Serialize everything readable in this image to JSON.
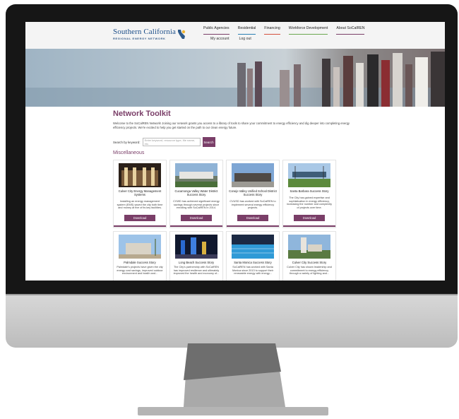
{
  "site": {
    "logo_main": "Southern California",
    "logo_sub": "REGIONAL ENERGY NETWORK"
  },
  "nav": {
    "items": [
      "Public Agencies",
      "Residential",
      "Financing",
      "Workforce Development",
      "About SoCalREN"
    ],
    "sub_items": [
      "My account",
      "Log out"
    ],
    "accent_colors": [
      "#7a3e68",
      "#2a7fb3",
      "#d4503c",
      "#6aa84f",
      "#7a3e68"
    ]
  },
  "page": {
    "title": "Network Toolkit",
    "intro": "Welcome to the SoCalREN Network! Joining our network grants you access to a library of tools to share your commitment to energy efficiency and dig deeper into completing energy efficiency projects. We're excited to help you get started on the path to our clean energy future.",
    "search_label": "Search by keyword:",
    "search_placeholder": "Enter keyword, resource type, file name, etc.",
    "search_button": "Search",
    "section_title": "Miscellaneous"
  },
  "cards": [
    {
      "title": "Culver City Energy Management Systems",
      "desc": "Installing an energy management system (EMS) saved the city both time and money at five of its key facilities.",
      "button": "Download"
    },
    {
      "title": "Cucamonga Valley Water District Success Story",
      "desc": "CVWD has achieved significant energy savings through several projects since enrolling with SoCalREN in 2014.",
      "button": "Download"
    },
    {
      "title": "Conejo Valley Unified School District Success Story",
      "desc": "CVUSD has worked with SoCalREN to implement several energy efficiency projects.",
      "button": "Download"
    },
    {
      "title": "Santa Barbara Success Story",
      "desc": "The City has gained expertise and sophistication in energy efficiency, increasing the number and complexity of projects over time.",
      "button": "Download"
    },
    {
      "title": "Palmdale Success Story",
      "desc": "Palmdale's projects have given the city energy cost savings, improved outdoor environment and health and...",
      "button": ""
    },
    {
      "title": "Long Beach Success Story",
      "desc": "The City's partnership with SoCalREN has improved resilience and ultimately improved the health and economy of...",
      "button": ""
    },
    {
      "title": "Santa Monica Success Story",
      "desc": "SoCalREN has worked with Santa Monica since 2013 to support their renewable energy with energy...",
      "button": ""
    },
    {
      "title": "Culver City Success Story",
      "desc": "Culver City has shown leadership and commitment to energy efficiency through a variety of lighting and...",
      "button": ""
    }
  ],
  "colors": {
    "brand": "#7a3e68",
    "logo_blue": "#1d4f8a"
  }
}
